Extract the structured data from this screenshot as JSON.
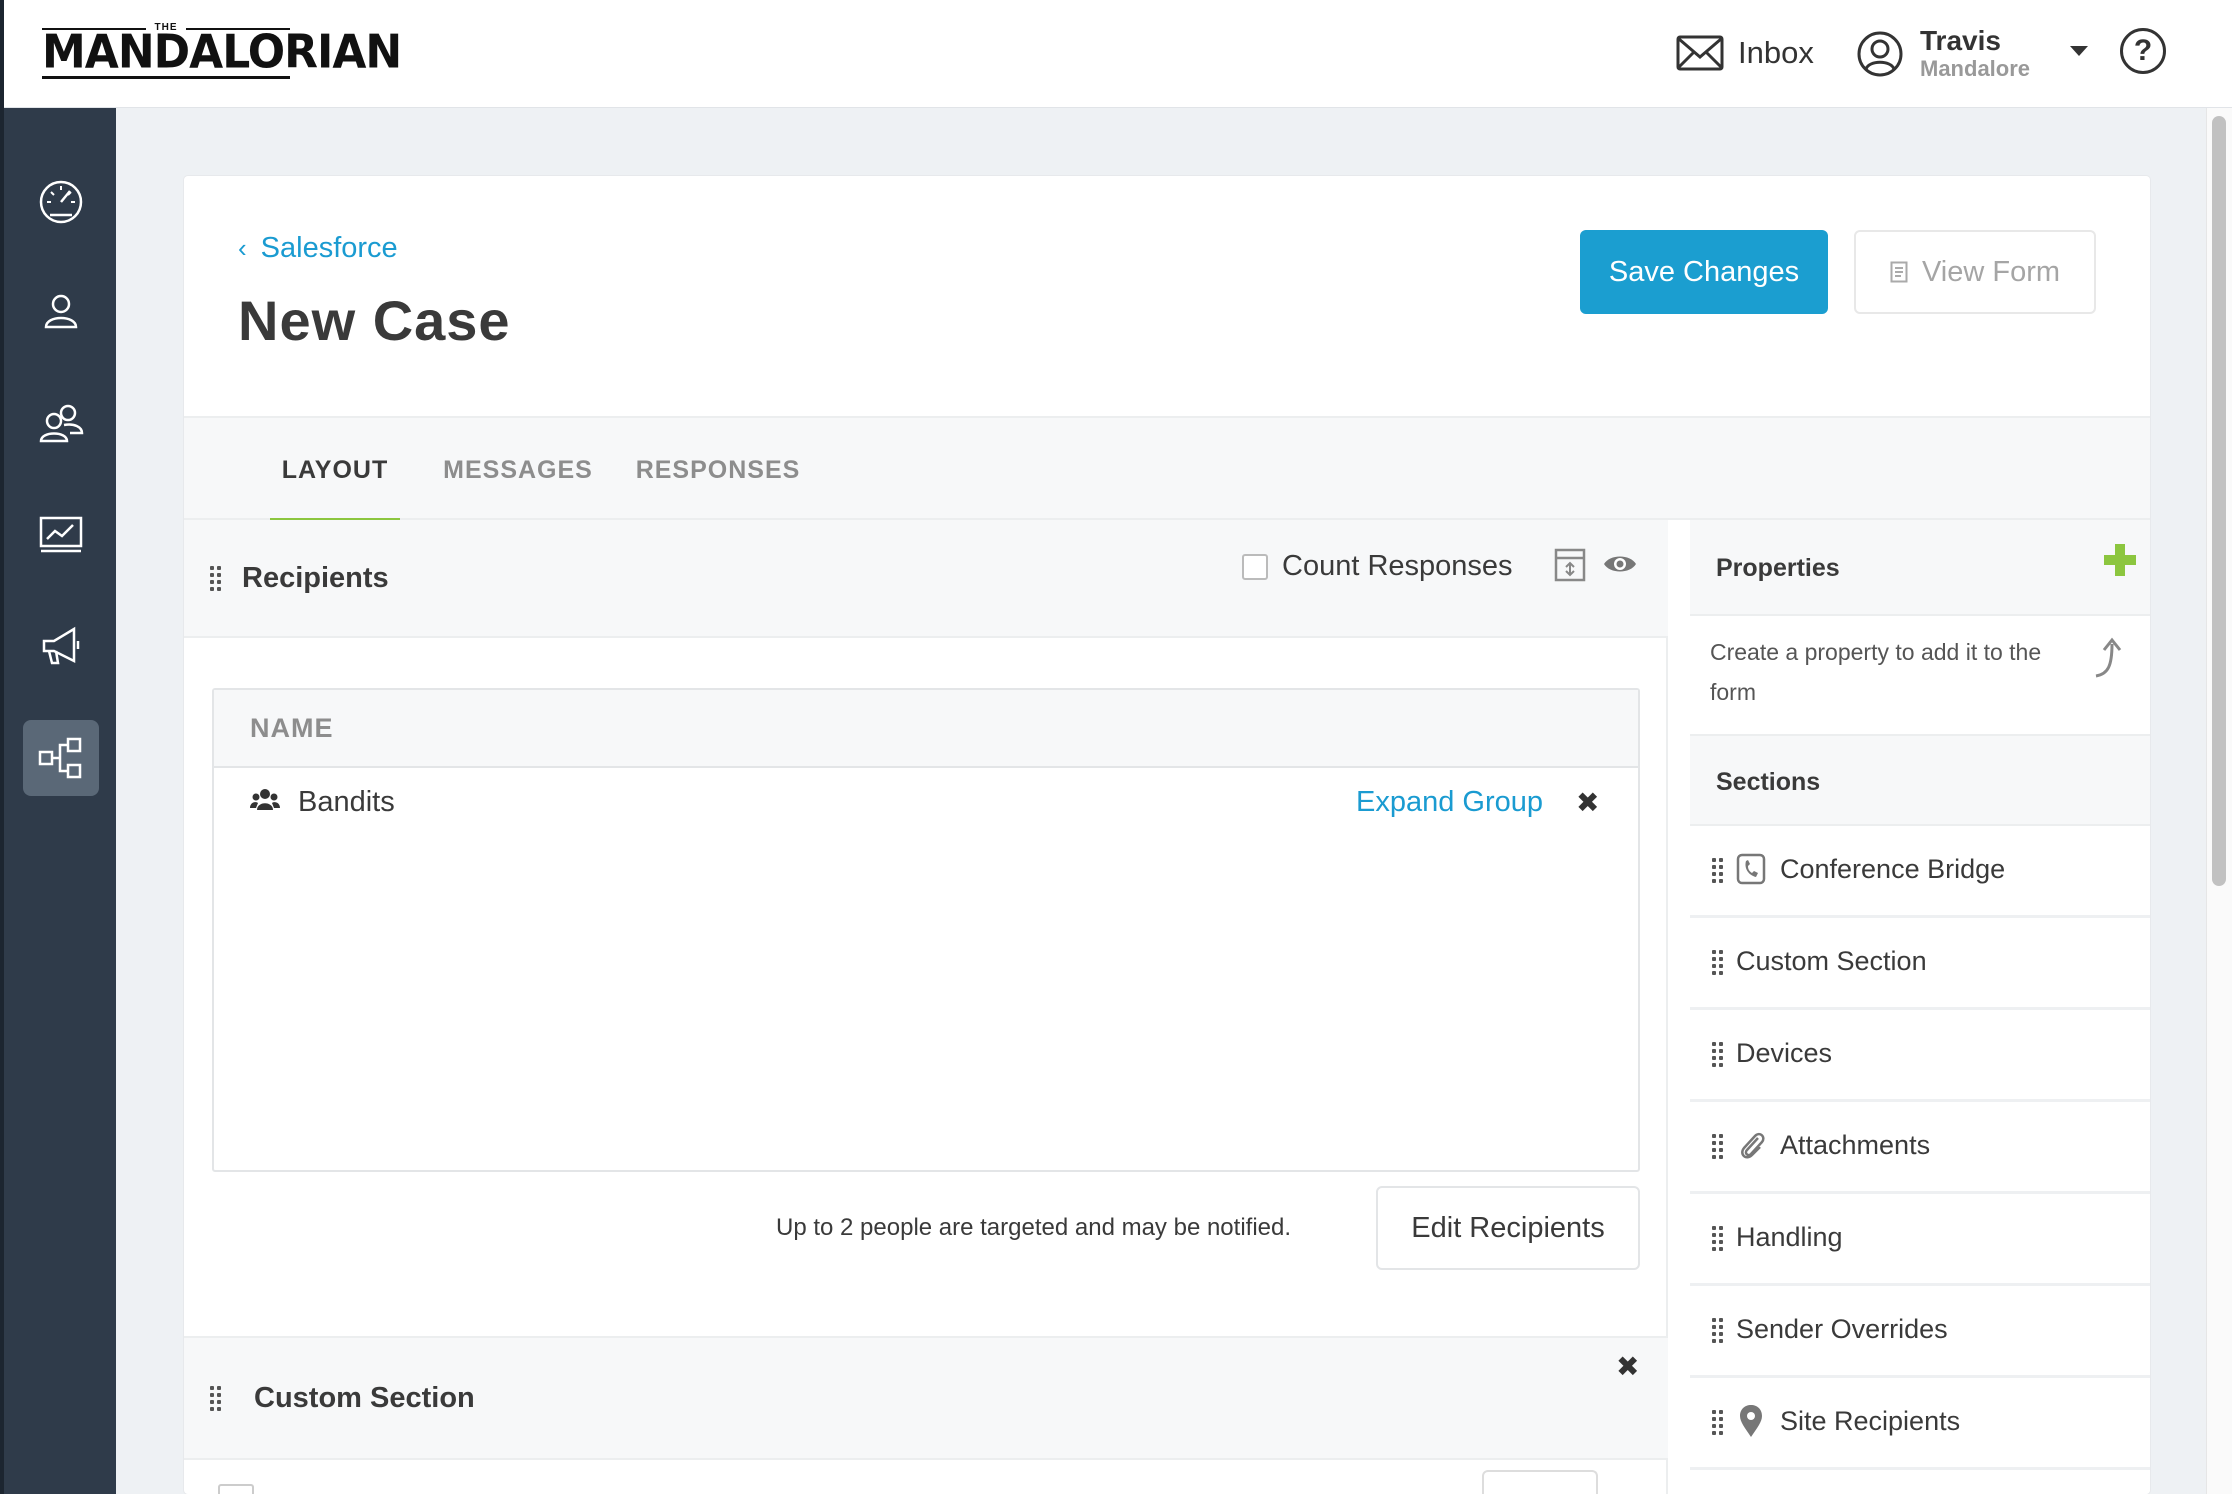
{
  "header": {
    "logo_small": "THE",
    "logo_word": "MANDALORIAN",
    "inbox_label": "Inbox",
    "user_name": "Travis",
    "user_sub": "Mandalore",
    "help": "?"
  },
  "sidebar": {
    "items": [
      {
        "icon": "dashboard-gauge-icon"
      },
      {
        "icon": "user-icon"
      },
      {
        "icon": "groups-icon"
      },
      {
        "icon": "reports-chart-icon"
      },
      {
        "icon": "megaphone-icon"
      },
      {
        "icon": "workflow-icon",
        "active": true
      }
    ]
  },
  "page": {
    "breadcrumb": "Salesforce",
    "title": "New Case",
    "save_label": "Save Changes",
    "view_label": "View Form"
  },
  "tabs": [
    {
      "label": "LAYOUT",
      "active": true
    },
    {
      "label": "MESSAGES"
    },
    {
      "label": "RESPONSES"
    }
  ],
  "recipients": {
    "title": "Recipients",
    "count_label": "Count Responses",
    "count_checked": false,
    "column_header": "NAME",
    "rows": [
      {
        "name": "Bandits",
        "action": "Expand Group",
        "remove": "✖"
      }
    ],
    "targeted_text": "Up to 2 people are targeted and may be notified.",
    "edit_label": "Edit Recipients"
  },
  "custom_section": {
    "title": "Custom Section",
    "remove": "✖"
  },
  "properties": {
    "title": "Properties",
    "description": "Create a property to add it to the form",
    "sections_title": "Sections",
    "sections": [
      {
        "label": "Conference Bridge",
        "icon": "phone-icon"
      },
      {
        "label": "Custom Section",
        "icon": ""
      },
      {
        "label": "Devices",
        "icon": ""
      },
      {
        "label": "Attachments",
        "icon": "paperclip-icon"
      },
      {
        "label": "Handling",
        "icon": ""
      },
      {
        "label": "Sender Overrides",
        "icon": ""
      },
      {
        "label": "Site Recipients",
        "icon": "map-pin-icon"
      }
    ]
  },
  "colors": {
    "accent": "#1b9ed0",
    "tab_underline": "#8cc63f",
    "sidebar": "#2f3b4a",
    "plus": "#8cc63f"
  }
}
